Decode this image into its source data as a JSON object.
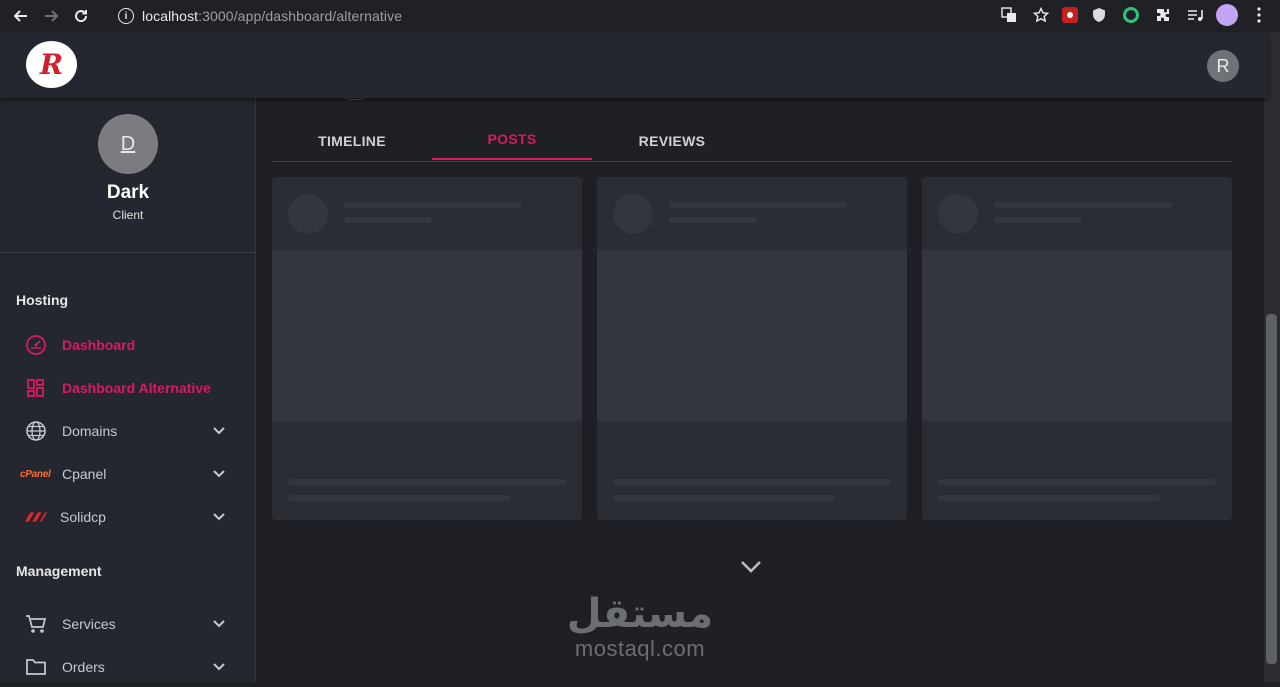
{
  "browser": {
    "url_host": "localhost",
    "url_path": ":3000/app/dashboard/alternative"
  },
  "header": {
    "logo_letter": "R",
    "user_avatar_letter": "R"
  },
  "sidebar": {
    "profile": {
      "avatar_letter": "D",
      "name": "Dark",
      "role": "Client"
    },
    "sections": [
      {
        "title": "Hosting",
        "items": [
          {
            "label": "Dashboard",
            "icon": "speedometer-icon",
            "active": true,
            "expandable": false
          },
          {
            "label": "Dashboard Alternative",
            "icon": "dashboard-grid-icon",
            "active": true,
            "expandable": false
          },
          {
            "label": "Domains",
            "icon": "globe-icon",
            "active": false,
            "expandable": true
          },
          {
            "label": "Cpanel",
            "icon": "cpanel-logo-icon",
            "active": false,
            "expandable": true,
            "badge": "cPanel"
          },
          {
            "label": "Solidcp",
            "icon": "solidcp-logo-icon",
            "active": false,
            "expandable": true
          }
        ]
      },
      {
        "title": "Management",
        "items": [
          {
            "label": "Services",
            "icon": "cart-icon",
            "active": false,
            "expandable": true
          },
          {
            "label": "Orders",
            "icon": "folder-icon",
            "active": false,
            "expandable": true
          }
        ]
      }
    ]
  },
  "tabs": [
    {
      "label": "TIMELINE",
      "active": false
    },
    {
      "label": "POSTS",
      "active": true
    },
    {
      "label": "REVIEWS",
      "active": false
    }
  ],
  "watermark": {
    "arabic": "مستقل",
    "latin": "mostaql.com"
  },
  "colors": {
    "accent": "#d81b60",
    "sidebar_bg": "#24272f",
    "main_bg": "#1e2026",
    "card_bg": "#2a2d34",
    "skeleton": "#33363e"
  }
}
